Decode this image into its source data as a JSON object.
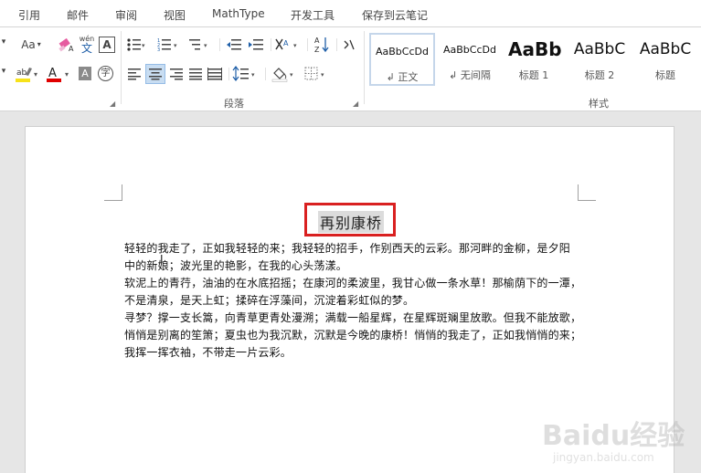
{
  "menu": {
    "tabs": [
      "引用",
      "邮件",
      "审阅",
      "视图",
      "MathType",
      "开发工具",
      "保存到云笔记"
    ]
  },
  "ribbon": {
    "font_size_btn": "Aa",
    "phonetic_btn": "wén",
    "char_border_btn": "A",
    "font_color_btn": "A",
    "char_shade_btn": "A",
    "enclose_btn": "字",
    "sort_btn": "A↓Z",
    "paragraph_label": "段落",
    "styles_label": "样式",
    "styles": [
      {
        "sample": "AaBbCcDd",
        "name": "↲ 正文",
        "selected": true
      },
      {
        "sample": "AaBbCcDd",
        "name": "↲ 无间隔",
        "selected": false
      },
      {
        "sample": "AaBb",
        "name": "标题 1",
        "selected": false
      },
      {
        "sample": "AaBbC",
        "name": "标题 2",
        "selected": false
      },
      {
        "sample": "AaBbC",
        "name": "标题",
        "selected": false
      }
    ]
  },
  "document": {
    "title": "再别康桥",
    "lines": [
      "轻轻的我走了，正如我轻轻的来；我轻轻的招手，作别西天的云彩。那河畔的金柳，是夕阳",
      "中的新娘；波光里的艳影，在我的心头荡漾。",
      "软泥上的青荇，油油的在水底招摇；在康河的柔波里，我甘心做一条水草！那榆荫下的一潭，",
      "不是清泉，是天上虹；揉碎在浮藻间，沉淀着彩虹似的梦。",
      "寻梦？撑一支长篙，向青草更青处漫溯；满载一船星辉，在星辉斑斓里放歌。但我不能放歌，",
      "悄悄是别离的笙箫；夏虫也为我沉默，沉默是今晚的康桥！悄悄的我走了，正如我悄悄的来；",
      "我挥一挥衣袖，不带走一片云彩。"
    ]
  },
  "watermark": {
    "main": "Baidu经验",
    "sub": "jingyan.baidu.com"
  },
  "colors": {
    "highlight_bar": "#f7e21a",
    "font_color_bar": "#e00000",
    "title_box_border": "#d92020",
    "selected_style_border": "#c5d6ea"
  }
}
